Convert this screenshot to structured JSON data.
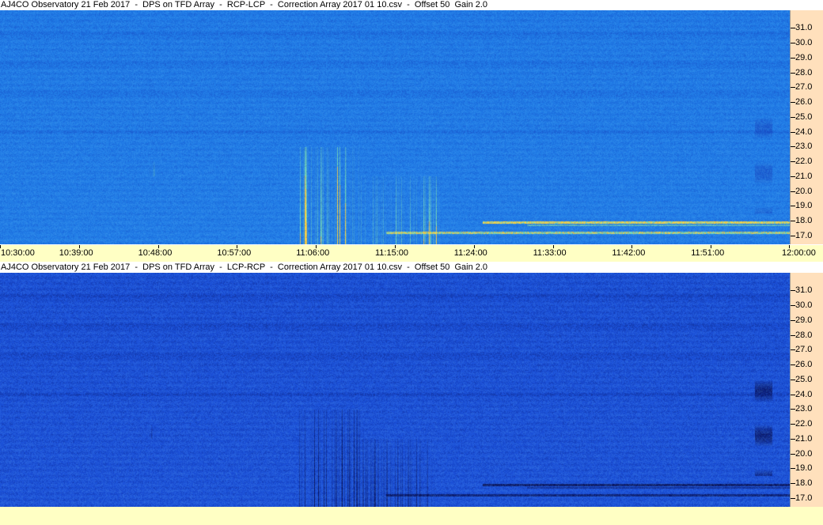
{
  "panels": [
    {
      "title": "AJ4CO Observatory 21 Feb 2017  -  DPS on TFD Array  -  RCP-LCP  -  Correction Array 2017 01 10.csv  -  Offset 50  Gain 2.0",
      "palette": "bright",
      "colors": {
        "base": "#1f7ae6",
        "dark": "#1230b0",
        "bright": "#9cff9c",
        "hot": "#ffd23a"
      }
    },
    {
      "title": "AJ4CO Observatory 21 Feb 2017  -  DPS on TFD Array  -  LCP-RCP  -  Correction Array 2017 01 10.csv  -  Offset 50  Gain 2.0",
      "palette": "dark",
      "colors": {
        "base": "#1a4fd8",
        "dark": "#07105a",
        "bright": "#a0ffb0",
        "hot": "#ffffff"
      }
    }
  ],
  "chart_data": {
    "type": "heatmap",
    "x_axis": {
      "ticks": [
        "10:30:00",
        "10:39:00",
        "10:48:00",
        "10:57:00",
        "11:06:00",
        "11:15:00",
        "11:24:00",
        "11:33:00",
        "11:42:00",
        "11:51:00",
        "12:00:00"
      ],
      "range": [
        "10:30:00",
        "12:00:00"
      ]
    },
    "y_axis": {
      "ticks": [
        "17.0",
        "18.0",
        "19.0",
        "20.0",
        "21.0",
        "22.0",
        "23.0",
        "24.0",
        "25.0",
        "26.0",
        "27.0",
        "28.0",
        "29.0",
        "30.0",
        "31.0"
      ],
      "range": [
        16.4,
        32.2
      ]
    },
    "features": {
      "burst_bands": [
        {
          "t_start": "11:04:00",
          "t_end": "11:11:00",
          "f_low": 16.4,
          "f_high": 23.0,
          "strength": 0.9
        },
        {
          "t_start": "11:11:00",
          "t_end": "11:20:00",
          "f_low": 16.4,
          "f_high": 21.0,
          "strength": 0.55
        },
        {
          "t_start": "10:47:00",
          "t_end": "10:48:00",
          "f_low": 21.0,
          "f_high": 22.0,
          "strength": 0.4
        }
      ],
      "horizontal_lines": [
        {
          "f": 17.2,
          "t_start": "11:14:00",
          "t_end": "12:00:00",
          "strength": 0.8
        },
        {
          "f": 17.9,
          "t_start": "11:25:00",
          "t_end": "12:00:00",
          "strength": 1.0
        },
        {
          "f": 17.7,
          "t_start": "11:30:00",
          "t_end": "12:00:00",
          "strength": 0.5
        }
      ],
      "dark_bands_freq": [
        24.0,
        26.6,
        28.6,
        30.6
      ],
      "right_edge_burst": {
        "t_start": "11:56:00",
        "t_end": "11:58:00",
        "f_low": 18.5,
        "f_high": 25.0
      }
    }
  }
}
